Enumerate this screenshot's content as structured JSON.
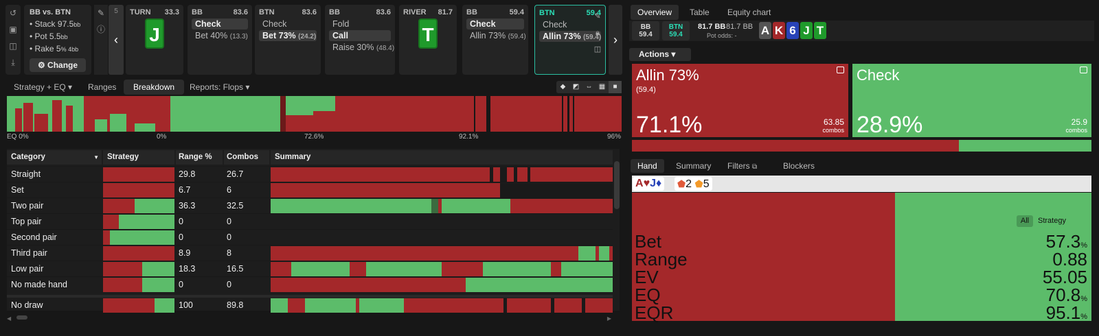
{
  "left_rail": {
    "icons": [
      "reset-icon",
      "save-icon",
      "gamepad-icon",
      "export-icon"
    ]
  },
  "info": {
    "title": "BB vs. BTN",
    "stack": "Stack 97.5",
    "stack_unit": "bb",
    "pot": "Pot 5.5",
    "pot_unit": "bb",
    "rake": "Rake 5",
    "rake_mid": "% 4",
    "rake_unit": "bb",
    "change_label": "Change"
  },
  "step_number": "5",
  "cards": [
    {
      "pos": "TURN",
      "val": "33.3",
      "board": "J",
      "actions": []
    },
    {
      "pos": "BB",
      "val": "83.6",
      "actions": [
        {
          "label": "Check",
          "sel": true
        },
        {
          "label": "Bet 40%",
          "extra": "(13.3)",
          "sel": false
        }
      ]
    },
    {
      "pos": "BTN",
      "val": "83.6",
      "actions": [
        {
          "label": "Check",
          "sel": false
        },
        {
          "label": "Bet 73%",
          "extra": "(24.2)",
          "sel": true
        }
      ]
    },
    {
      "pos": "BB",
      "val": "83.6",
      "actions": [
        {
          "label": "Fold",
          "sel": false
        },
        {
          "label": "Call",
          "sel": true
        },
        {
          "label": "Raise 30%",
          "extra": "(48.4)",
          "sel": false
        }
      ]
    },
    {
      "pos": "RIVER",
      "val": "81.7",
      "board": "T",
      "actions": []
    },
    {
      "pos": "BB",
      "val": "59.4",
      "actions": [
        {
          "label": "Check",
          "sel": true
        },
        {
          "label": "Allin 73%",
          "extra": "(59.4)",
          "sel": false
        }
      ]
    },
    {
      "pos": "BTN",
      "val": "59.4",
      "actions": [
        {
          "label": "Check",
          "sel": false
        },
        {
          "label": "Allin 73%",
          "extra": "(59.4)",
          "sel": true
        }
      ]
    }
  ],
  "tabs": [
    "Strategy + EQ",
    "Ranges",
    "Breakdown",
    "Reports: Flops"
  ],
  "eq_labels": [
    "EQ 0%",
    "0%",
    "72.6%",
    "92.1%",
    "96%"
  ],
  "table": {
    "headers": [
      "Category",
      "Strategy",
      "Range %",
      "Combos",
      "Summary"
    ],
    "rows": [
      {
        "cat": "Straight",
        "range": "29.8",
        "combos": "26.7",
        "green": 0.0
      },
      {
        "cat": "Set",
        "range": "6.7",
        "combos": "6",
        "green": 0.0
      },
      {
        "cat": "Two pair",
        "range": "36.3",
        "combos": "32.5",
        "green": 0.56
      },
      {
        "cat": "Top pair",
        "range": "0",
        "combos": "0",
        "green": 0.78
      },
      {
        "cat": "Second pair",
        "range": "0",
        "combos": "0",
        "green": 0.9
      },
      {
        "cat": "Third pair",
        "range": "8.9",
        "combos": "8",
        "green": 0.0
      },
      {
        "cat": "Low pair",
        "range": "18.3",
        "combos": "16.5",
        "green": 0.45
      },
      {
        "cat": "No made hand",
        "range": "0",
        "combos": "0",
        "green": 0.45
      },
      {
        "cat": "No draw",
        "range": "100",
        "combos": "89.8",
        "green": 0.28
      }
    ]
  },
  "right": {
    "tabs": [
      "Overview",
      "Table",
      "Equity chart"
    ],
    "bb": {
      "label": "BB",
      "val": "59.4"
    },
    "btn": {
      "label": "BTN",
      "val": "59.4"
    },
    "pot1": "81.7 BB",
    "pot2": "81.7 BB",
    "pot_odds": "Pot odds:",
    "pot_odds_val": "-",
    "board": [
      {
        "c": "A",
        "col": "#555"
      },
      {
        "c": "K",
        "col": "#a4282a"
      },
      {
        "c": "6",
        "col": "#2843b8"
      },
      {
        "c": "J",
        "col": "#1f9a2b"
      },
      {
        "c": "T",
        "col": "#1f9a2b"
      }
    ],
    "actions_label": "Actions",
    "allin": {
      "name": "Allin 73%",
      "sub": "(59.4)",
      "pct": "71.1%",
      "combos": "63.85",
      "combos_lbl": "combos"
    },
    "check": {
      "name": "Check",
      "pct": "28.9%",
      "combos": "25.9",
      "combos_lbl": "combos"
    },
    "allin_frac": 0.711,
    "hand_tabs": [
      "Hand",
      "Summary",
      "Filters",
      "Blockers"
    ],
    "hand_chip": {
      "a": "A",
      "s1": "♥",
      "j": "J",
      "s2": "♦"
    },
    "blockers": [
      {
        "n": "2"
      },
      {
        "n": "5"
      }
    ],
    "hand_red_frac": 0.573,
    "all_label": "All",
    "strategy_label": "Strategy",
    "stats": [
      {
        "k": "Bet",
        "v": "57.3",
        "u": "%"
      },
      {
        "k": "Range",
        "v": "0.88",
        "u": ""
      },
      {
        "k": "EV",
        "v": "55.05",
        "u": ""
      },
      {
        "k": "EQ",
        "v": "70.8",
        "u": "%"
      },
      {
        "k": "EQR",
        "v": "95.1",
        "u": "%"
      }
    ]
  }
}
